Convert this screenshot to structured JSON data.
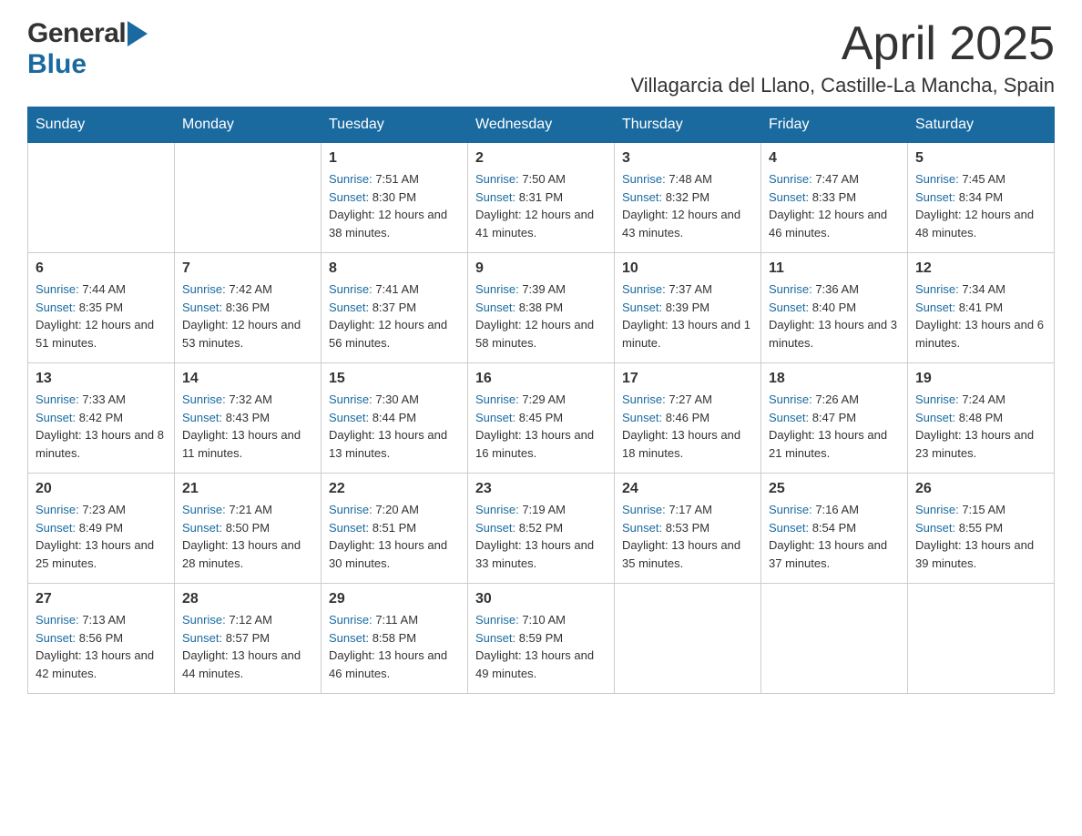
{
  "header": {
    "logo_general": "General",
    "logo_blue": "Blue",
    "month_title": "April 2025",
    "location": "Villagarcia del Llano, Castille-La Mancha, Spain"
  },
  "days_of_week": [
    "Sunday",
    "Monday",
    "Tuesday",
    "Wednesday",
    "Thursday",
    "Friday",
    "Saturday"
  ],
  "weeks": [
    [
      {
        "day": "",
        "sunrise": "",
        "sunset": "",
        "daylight": ""
      },
      {
        "day": "",
        "sunrise": "",
        "sunset": "",
        "daylight": ""
      },
      {
        "day": "1",
        "sunrise": "7:51 AM",
        "sunset": "8:30 PM",
        "daylight": "12 hours and 38 minutes."
      },
      {
        "day": "2",
        "sunrise": "7:50 AM",
        "sunset": "8:31 PM",
        "daylight": "12 hours and 41 minutes."
      },
      {
        "day": "3",
        "sunrise": "7:48 AM",
        "sunset": "8:32 PM",
        "daylight": "12 hours and 43 minutes."
      },
      {
        "day": "4",
        "sunrise": "7:47 AM",
        "sunset": "8:33 PM",
        "daylight": "12 hours and 46 minutes."
      },
      {
        "day": "5",
        "sunrise": "7:45 AM",
        "sunset": "8:34 PM",
        "daylight": "12 hours and 48 minutes."
      }
    ],
    [
      {
        "day": "6",
        "sunrise": "7:44 AM",
        "sunset": "8:35 PM",
        "daylight": "12 hours and 51 minutes."
      },
      {
        "day": "7",
        "sunrise": "7:42 AM",
        "sunset": "8:36 PM",
        "daylight": "12 hours and 53 minutes."
      },
      {
        "day": "8",
        "sunrise": "7:41 AM",
        "sunset": "8:37 PM",
        "daylight": "12 hours and 56 minutes."
      },
      {
        "day": "9",
        "sunrise": "7:39 AM",
        "sunset": "8:38 PM",
        "daylight": "12 hours and 58 minutes."
      },
      {
        "day": "10",
        "sunrise": "7:37 AM",
        "sunset": "8:39 PM",
        "daylight": "13 hours and 1 minute."
      },
      {
        "day": "11",
        "sunrise": "7:36 AM",
        "sunset": "8:40 PM",
        "daylight": "13 hours and 3 minutes."
      },
      {
        "day": "12",
        "sunrise": "7:34 AM",
        "sunset": "8:41 PM",
        "daylight": "13 hours and 6 minutes."
      }
    ],
    [
      {
        "day": "13",
        "sunrise": "7:33 AM",
        "sunset": "8:42 PM",
        "daylight": "13 hours and 8 minutes."
      },
      {
        "day": "14",
        "sunrise": "7:32 AM",
        "sunset": "8:43 PM",
        "daylight": "13 hours and 11 minutes."
      },
      {
        "day": "15",
        "sunrise": "7:30 AM",
        "sunset": "8:44 PM",
        "daylight": "13 hours and 13 minutes."
      },
      {
        "day": "16",
        "sunrise": "7:29 AM",
        "sunset": "8:45 PM",
        "daylight": "13 hours and 16 minutes."
      },
      {
        "day": "17",
        "sunrise": "7:27 AM",
        "sunset": "8:46 PM",
        "daylight": "13 hours and 18 minutes."
      },
      {
        "day": "18",
        "sunrise": "7:26 AM",
        "sunset": "8:47 PM",
        "daylight": "13 hours and 21 minutes."
      },
      {
        "day": "19",
        "sunrise": "7:24 AM",
        "sunset": "8:48 PM",
        "daylight": "13 hours and 23 minutes."
      }
    ],
    [
      {
        "day": "20",
        "sunrise": "7:23 AM",
        "sunset": "8:49 PM",
        "daylight": "13 hours and 25 minutes."
      },
      {
        "day": "21",
        "sunrise": "7:21 AM",
        "sunset": "8:50 PM",
        "daylight": "13 hours and 28 minutes."
      },
      {
        "day": "22",
        "sunrise": "7:20 AM",
        "sunset": "8:51 PM",
        "daylight": "13 hours and 30 minutes."
      },
      {
        "day": "23",
        "sunrise": "7:19 AM",
        "sunset": "8:52 PM",
        "daylight": "13 hours and 33 minutes."
      },
      {
        "day": "24",
        "sunrise": "7:17 AM",
        "sunset": "8:53 PM",
        "daylight": "13 hours and 35 minutes."
      },
      {
        "day": "25",
        "sunrise": "7:16 AM",
        "sunset": "8:54 PM",
        "daylight": "13 hours and 37 minutes."
      },
      {
        "day": "26",
        "sunrise": "7:15 AM",
        "sunset": "8:55 PM",
        "daylight": "13 hours and 39 minutes."
      }
    ],
    [
      {
        "day": "27",
        "sunrise": "7:13 AM",
        "sunset": "8:56 PM",
        "daylight": "13 hours and 42 minutes."
      },
      {
        "day": "28",
        "sunrise": "7:12 AM",
        "sunset": "8:57 PM",
        "daylight": "13 hours and 44 minutes."
      },
      {
        "day": "29",
        "sunrise": "7:11 AM",
        "sunset": "8:58 PM",
        "daylight": "13 hours and 46 minutes."
      },
      {
        "day": "30",
        "sunrise": "7:10 AM",
        "sunset": "8:59 PM",
        "daylight": "13 hours and 49 minutes."
      },
      {
        "day": "",
        "sunrise": "",
        "sunset": "",
        "daylight": ""
      },
      {
        "day": "",
        "sunrise": "",
        "sunset": "",
        "daylight": ""
      },
      {
        "day": "",
        "sunrise": "",
        "sunset": "",
        "daylight": ""
      }
    ]
  ],
  "labels": {
    "sunrise": "Sunrise: ",
    "sunset": "Sunset: ",
    "daylight": "Daylight: "
  }
}
